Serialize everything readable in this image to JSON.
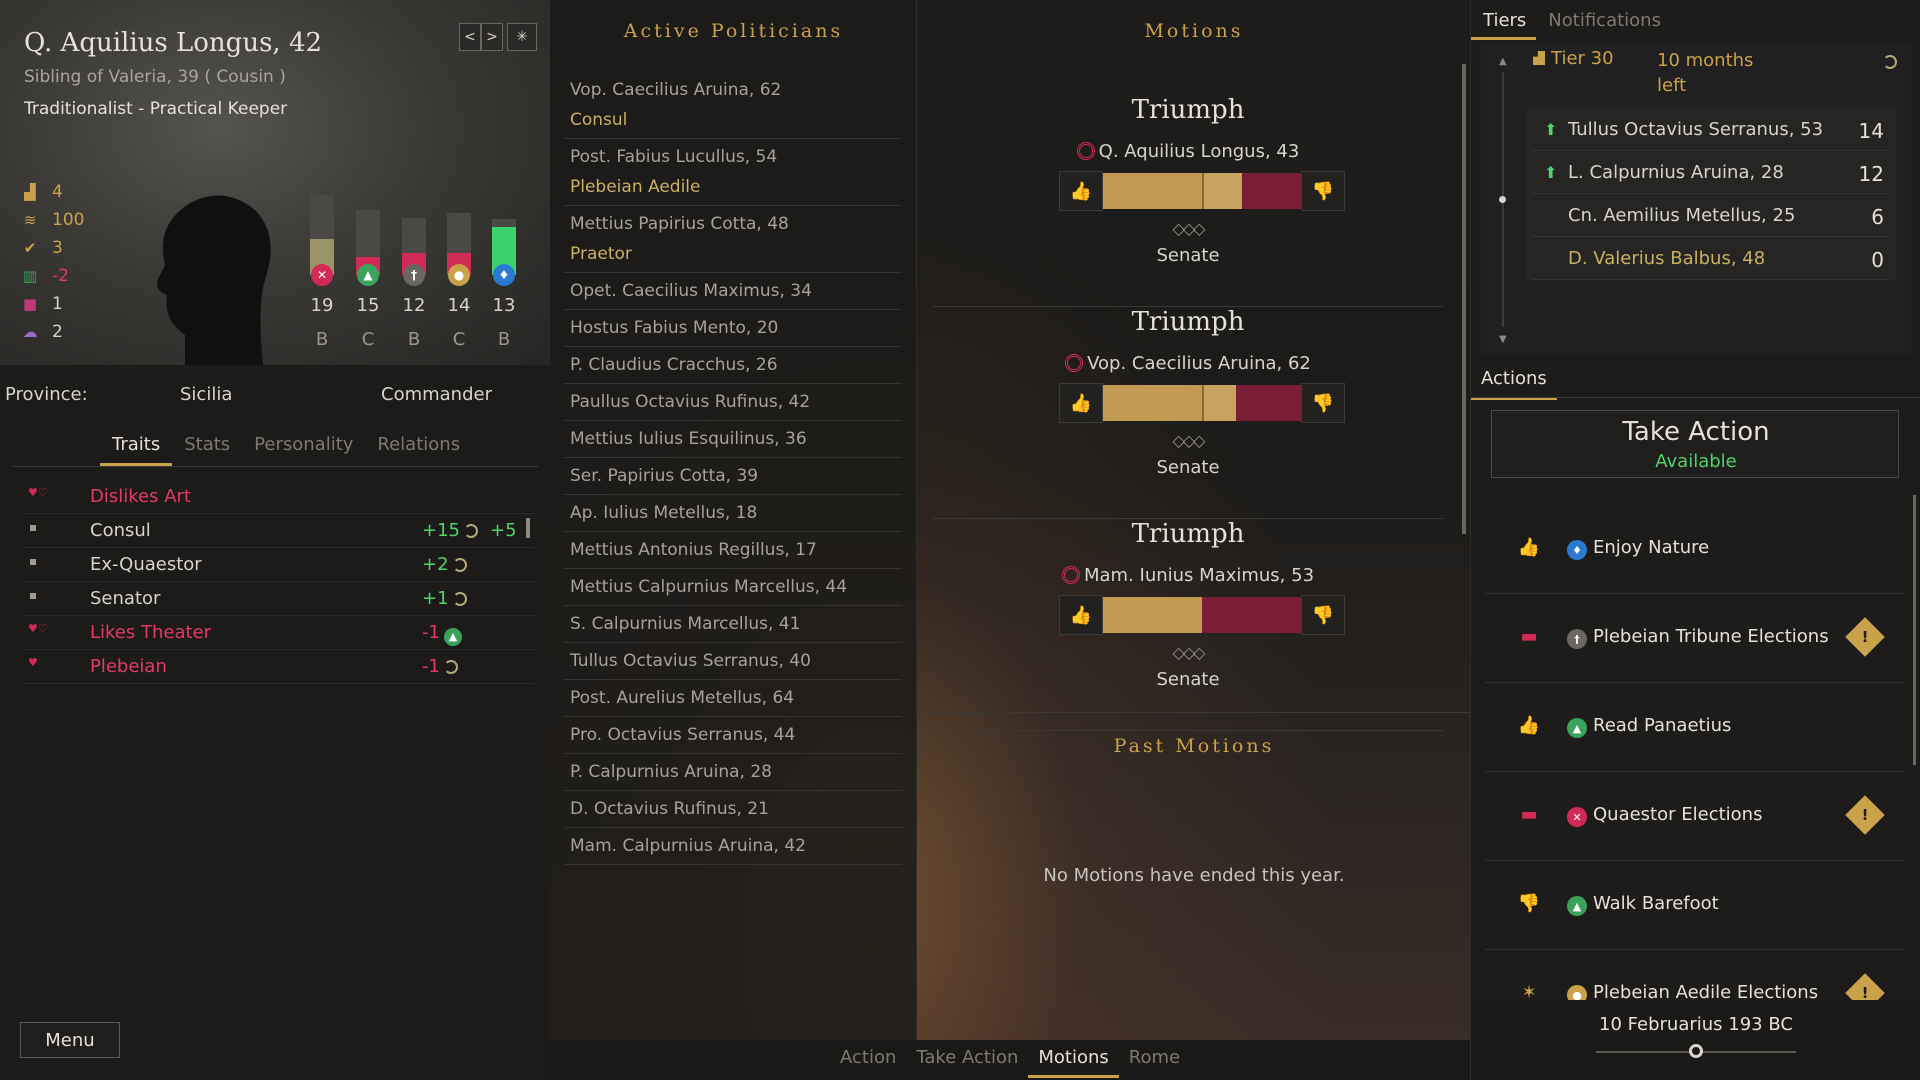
{
  "character": {
    "name": "Q. Aquilius Longus, 42",
    "relation": "Sibling of Valeria, 39 ( Cousin )",
    "ideology": "Traditionalist - Practical Keeper",
    "nav": {
      "prev": "<",
      "next": ">",
      "star": "✳"
    },
    "mini_stats": [
      {
        "icon": "influence-icon",
        "value": "4",
        "color": "#c9a24a"
      },
      {
        "icon": "coins-icon",
        "value": "100",
        "color": "#c9a24a"
      },
      {
        "icon": "laurel-icon",
        "value": "3",
        "color": "#c9a24a"
      },
      {
        "icon": "popularity-icon",
        "value": "-2",
        "color": "#e33a68"
      },
      {
        "icon": "family-icon",
        "value": "1",
        "color": "#d8d4cc"
      },
      {
        "icon": "mind-icon",
        "value": "2",
        "color": "#d8d4cc"
      }
    ],
    "bars": [
      {
        "value": "19",
        "grade": "B",
        "fill_ratio": 0.45,
        "color": "#9b9466",
        "badge": "✕",
        "badge_color": "#d02a55",
        "icon": "military-icon"
      },
      {
        "value": "15",
        "grade": "C",
        "fill_ratio": 0.28,
        "color": "#d02a55",
        "badge": "▲",
        "badge_color": "#3aa25a",
        "icon": "oratory-icon"
      },
      {
        "value": "12",
        "grade": "B",
        "fill_ratio": 0.38,
        "color": "#d02a55",
        "badge": "†",
        "badge_color": "#6a6760",
        "icon": "intrigue-icon"
      },
      {
        "value": "14",
        "grade": "C",
        "fill_ratio": 0.35,
        "color": "#d02a55",
        "badge": "●",
        "badge_color": "#c9a24a",
        "icon": "finance-icon"
      },
      {
        "value": "13",
        "grade": "B",
        "fill_ratio": 0.85,
        "color": "#3cd36e",
        "badge": "♦",
        "badge_color": "#2a7ad0",
        "icon": "piety-icon"
      }
    ],
    "province_label": "Province:",
    "province": "Sicilia",
    "role": "Commander"
  },
  "trait_tabs": [
    "Traits",
    "Stats",
    "Personality",
    "Relations"
  ],
  "traits": [
    {
      "name": "Dislikes Art",
      "negative": true,
      "heart": true,
      "v1": "",
      "v1_cls": "",
      "v1_icon": "",
      "v2": ""
    },
    {
      "name": "Consul",
      "negative": false,
      "heart": false,
      "v1": "+15",
      "v1_cls": "pos",
      "v1_icon": "cycle",
      "v2": "+5"
    },
    {
      "name": "Ex-Quaestor",
      "negative": false,
      "heart": false,
      "v1": "+2",
      "v1_cls": "pos",
      "v1_icon": "cycle",
      "v2": ""
    },
    {
      "name": "Senator",
      "negative": false,
      "heart": false,
      "v1": "+1",
      "v1_cls": "pos",
      "v1_icon": "cycle",
      "v2": ""
    },
    {
      "name": "Likes Theater",
      "negative": true,
      "heart": true,
      "v1": "-1",
      "v1_cls": "negv",
      "v1_icon": "green",
      "v2": ""
    },
    {
      "name": "Plebeian",
      "negative": true,
      "heart": true,
      "single": true,
      "v1": "-1",
      "v1_cls": "negv",
      "v1_icon": "cycle",
      "v2": ""
    }
  ],
  "menu_label": "Menu",
  "politicians": {
    "title": "Active Politicians",
    "list": [
      {
        "name": "Vop. Caecilius Aruina, 62",
        "office": "Consul"
      },
      {
        "name": "Post. Fabius Lucullus, 54",
        "office": "Plebeian Aedile"
      },
      {
        "name": "Mettius Papirius Cotta, 48",
        "office": "Praetor"
      },
      {
        "name": "Opet. Caecilius Maximus, 34",
        "office": ""
      },
      {
        "name": "Hostus Fabius Mento, 20",
        "office": ""
      },
      {
        "name": "P. Claudius Cracchus, 26",
        "office": ""
      },
      {
        "name": "Paullus Octavius Rufinus, 42",
        "office": ""
      },
      {
        "name": "Mettius Iulius Esquilinus, 36",
        "office": ""
      },
      {
        "name": "Ser. Papirius Cotta, 39",
        "office": ""
      },
      {
        "name": "Ap. Iulius Metellus, 18",
        "office": ""
      },
      {
        "name": "Mettius Antonius Regillus, 17",
        "office": ""
      },
      {
        "name": "Mettius Calpurnius Marcellus, 44",
        "office": ""
      },
      {
        "name": "S. Calpurnius Marcellus, 41",
        "office": ""
      },
      {
        "name": "Tullus Octavius Serranus, 40",
        "office": ""
      },
      {
        "name": "Post. Aurelius Metellus, 64",
        "office": ""
      },
      {
        "name": "Pro. Octavius Serranus, 44",
        "office": ""
      },
      {
        "name": "P. Calpurnius Aruina, 28",
        "office": ""
      },
      {
        "name": "D. Octavius Rufinus, 21",
        "office": ""
      },
      {
        "name": "Mam. Calpurnius Aruina, 42",
        "office": ""
      }
    ]
  },
  "motions": {
    "title": "Motions",
    "items": [
      {
        "name": "Triumph",
        "sponsor": "Q. Aquilius Longus, 43",
        "yes_ratio": 0.5,
        "yes2_ratio": 0.2,
        "diamonds": "◇◇◇",
        "chamber": "Senate"
      },
      {
        "name": "Triumph",
        "sponsor": "Vop. Caecilius Aruina, 62",
        "yes_ratio": 0.5,
        "yes2_ratio": 0.17,
        "diamonds": "◇◇◇",
        "chamber": "Senate"
      },
      {
        "name": "Triumph",
        "sponsor": "Mam. Iunius Maximus, 53",
        "yes_ratio": 0.5,
        "yes2_ratio": 0.0,
        "diamonds": "◇◇◇",
        "chamber": "Senate"
      }
    ],
    "past_title": "Past Motions",
    "past_empty": "No Motions have ended this year."
  },
  "right_tabs": [
    "Tiers",
    "Notifications"
  ],
  "tiers": {
    "label": "Tier 30",
    "time": "10 months left",
    "rows": [
      {
        "name": "Tullus Octavius Serranus, 53",
        "value": "14",
        "arrow": true,
        "gold": false
      },
      {
        "name": "L. Calpurnius Aruina, 28",
        "value": "12",
        "arrow": true,
        "gold": false
      },
      {
        "name": "Cn. Aemilius Metellus, 25",
        "value": "6",
        "arrow": false,
        "gold": false
      },
      {
        "name": "D. Valerius Balbus, 48",
        "value": "0",
        "arrow": false,
        "gold": true
      }
    ]
  },
  "actions": {
    "tab": "Actions",
    "take_action": "Take Action",
    "status": "Available",
    "list": [
      {
        "name": "Enjoy Nature",
        "lead": "thumbs-up-icon",
        "lead_glyph": "👍",
        "lead_color": "#c9a24a",
        "badge": "♦",
        "badge_color": "#2a7ad0",
        "warn": false
      },
      {
        "name": "Plebeian Tribune Elections",
        "lead": "wolf-icon",
        "lead_glyph": "▬",
        "lead_color": "#d02a55",
        "badge": "†",
        "badge_color": "#6a6760",
        "warn": true
      },
      {
        "name": "Read Panaetius",
        "lead": "thumbs-up-icon",
        "lead_glyph": "👍",
        "lead_color": "#c9a24a",
        "badge": "▲",
        "badge_color": "#3aa25a",
        "warn": false
      },
      {
        "name": "Quaestor Elections",
        "lead": "wolf-icon",
        "lead_glyph": "▬",
        "lead_color": "#d02a55",
        "badge": "✕",
        "badge_color": "#d02a55",
        "warn": true
      },
      {
        "name": "Walk Barefoot",
        "lead": "thumbs-down-icon",
        "lead_glyph": "👎",
        "lead_color": "#d02a55",
        "badge": "▲",
        "badge_color": "#3aa25a",
        "warn": false
      },
      {
        "name": "Plebeian Aedile Elections",
        "lead": "eagle-icon",
        "lead_glyph": "✶",
        "lead_color": "#c9a24a",
        "badge": "●",
        "badge_color": "#c9a24a",
        "warn": true
      }
    ],
    "warn_glyph": "!"
  },
  "date": {
    "text": "10 Februarius 193 BC",
    "slider_ratio": 0.5
  },
  "bottom_nav": [
    "Action",
    "Take Action",
    "Motions",
    "Rome"
  ],
  "bottom_nav_active": 2
}
